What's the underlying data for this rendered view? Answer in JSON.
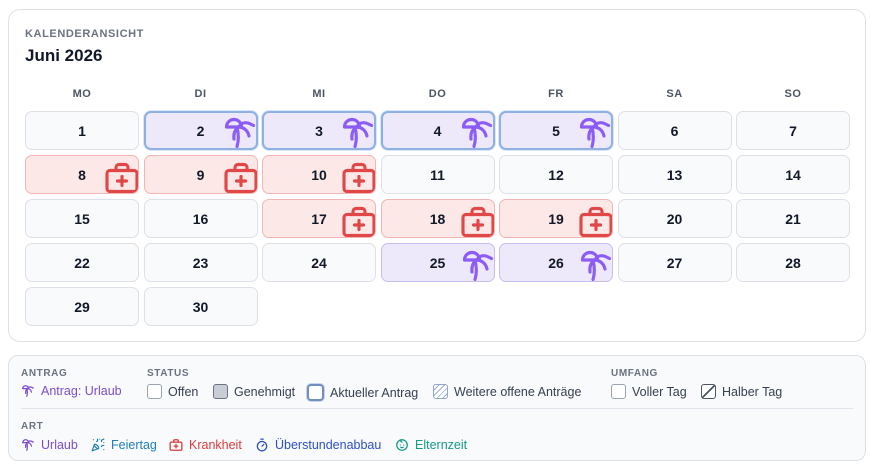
{
  "calendar": {
    "overline": "KALENDERANSICHT",
    "title": "Juni 2026",
    "weekdays": [
      "MO",
      "DI",
      "MI",
      "DO",
      "FR",
      "SA",
      "SO"
    ],
    "days": [
      {
        "n": "1",
        "type": "none"
      },
      {
        "n": "2",
        "type": "vacation",
        "current": true
      },
      {
        "n": "3",
        "type": "vacation",
        "current": true
      },
      {
        "n": "4",
        "type": "vacation",
        "current": true
      },
      {
        "n": "5",
        "type": "vacation",
        "current": true
      },
      {
        "n": "6",
        "type": "none"
      },
      {
        "n": "7",
        "type": "none"
      },
      {
        "n": "8",
        "type": "sick"
      },
      {
        "n": "9",
        "type": "sick"
      },
      {
        "n": "10",
        "type": "sick"
      },
      {
        "n": "11",
        "type": "none"
      },
      {
        "n": "12",
        "type": "none"
      },
      {
        "n": "13",
        "type": "none"
      },
      {
        "n": "14",
        "type": "none"
      },
      {
        "n": "15",
        "type": "none"
      },
      {
        "n": "16",
        "type": "none"
      },
      {
        "n": "17",
        "type": "sick"
      },
      {
        "n": "18",
        "type": "sick"
      },
      {
        "n": "19",
        "type": "sick"
      },
      {
        "n": "20",
        "type": "none"
      },
      {
        "n": "21",
        "type": "none"
      },
      {
        "n": "22",
        "type": "none"
      },
      {
        "n": "23",
        "type": "none"
      },
      {
        "n": "24",
        "type": "none"
      },
      {
        "n": "25",
        "type": "vacation"
      },
      {
        "n": "26",
        "type": "vacation"
      },
      {
        "n": "27",
        "type": "none"
      },
      {
        "n": "28",
        "type": "none"
      },
      {
        "n": "29",
        "type": "none"
      },
      {
        "n": "30",
        "type": "none"
      }
    ]
  },
  "legend": {
    "antrag": {
      "heading": "ANTRAG",
      "item": "Antrag: Urlaub",
      "icon": "palm-tree-icon"
    },
    "status": {
      "heading": "STATUS",
      "items": [
        "Offen",
        "Genehmigt",
        "Aktueller Antrag",
        "Weitere offene Anträge"
      ]
    },
    "umfang": {
      "heading": "UMFANG",
      "items": [
        "Voller Tag",
        "Halber Tag"
      ]
    },
    "art": {
      "heading": "ART",
      "items": [
        {
          "label": "Urlaub",
          "icon": "palm-tree-icon",
          "color": "#7c4dcc"
        },
        {
          "label": "Feiertag",
          "icon": "party-popper-icon",
          "color": "#1f7fb6"
        },
        {
          "label": "Krankheit",
          "icon": "medical-bag-icon",
          "color": "#dc3b3b"
        },
        {
          "label": "Überstundenabbau",
          "icon": "timer-icon",
          "color": "#2f4fc7"
        },
        {
          "label": "Elternzeit",
          "icon": "baby-icon",
          "color": "#159a86"
        }
      ]
    }
  },
  "colors": {
    "vacation": "#8b5cf6",
    "sick": "#e04848",
    "current_border": "#8fb0e3"
  }
}
